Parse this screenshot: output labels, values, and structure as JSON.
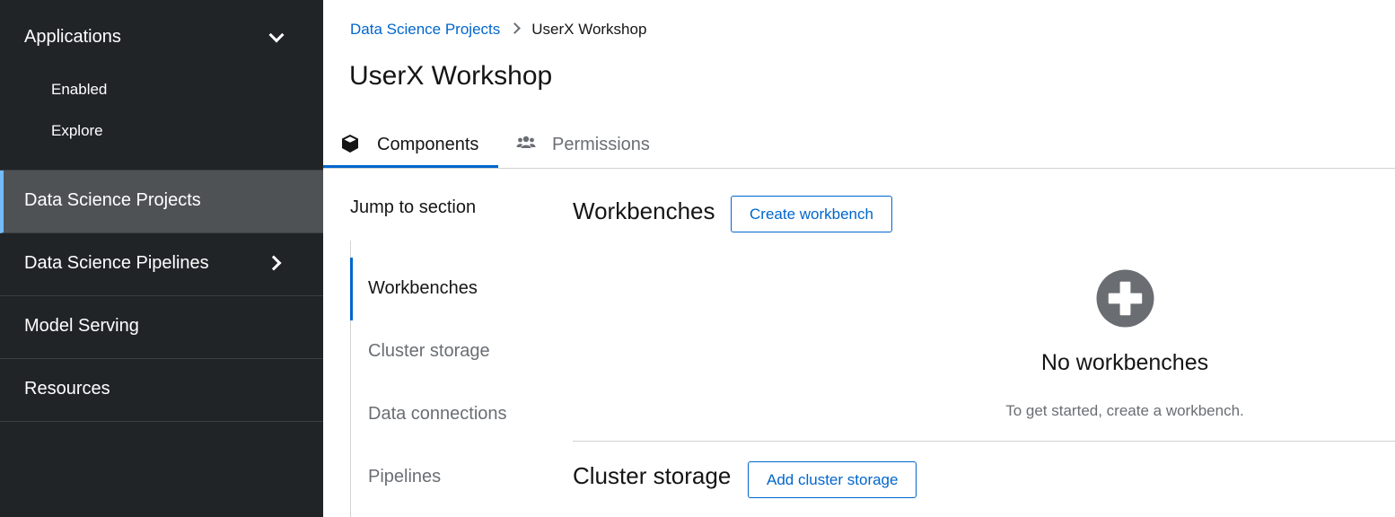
{
  "sidebar": {
    "applications": {
      "label": "Applications",
      "subitems": [
        "Enabled",
        "Explore"
      ]
    },
    "items": [
      {
        "label": "Data Science Projects",
        "active": true
      },
      {
        "label": "Data Science Pipelines"
      },
      {
        "label": "Model Serving"
      },
      {
        "label": "Resources"
      }
    ]
  },
  "breadcrumb": {
    "parent": "Data Science Projects",
    "current": "UserX Workshop"
  },
  "page": {
    "title": "UserX Workshop"
  },
  "tabs": [
    {
      "label": "Components",
      "icon": "cube-icon",
      "active": true
    },
    {
      "label": "Permissions",
      "icon": "users-icon"
    }
  ],
  "jump": {
    "title": "Jump to section",
    "items": [
      "Workbenches",
      "Cluster storage",
      "Data connections",
      "Pipelines"
    ]
  },
  "workbenches": {
    "title": "Workbenches",
    "button": "Create workbench",
    "empty_title": "No workbenches",
    "empty_body": "To get started, create a workbench."
  },
  "cluster_storage": {
    "title": "Cluster storage",
    "button": "Add cluster storage"
  },
  "colors": {
    "sidebar_bg": "#212427",
    "sidebar_active": "#4f5255",
    "accent": "#0066cc",
    "active_indicator": "#73bcf7"
  }
}
